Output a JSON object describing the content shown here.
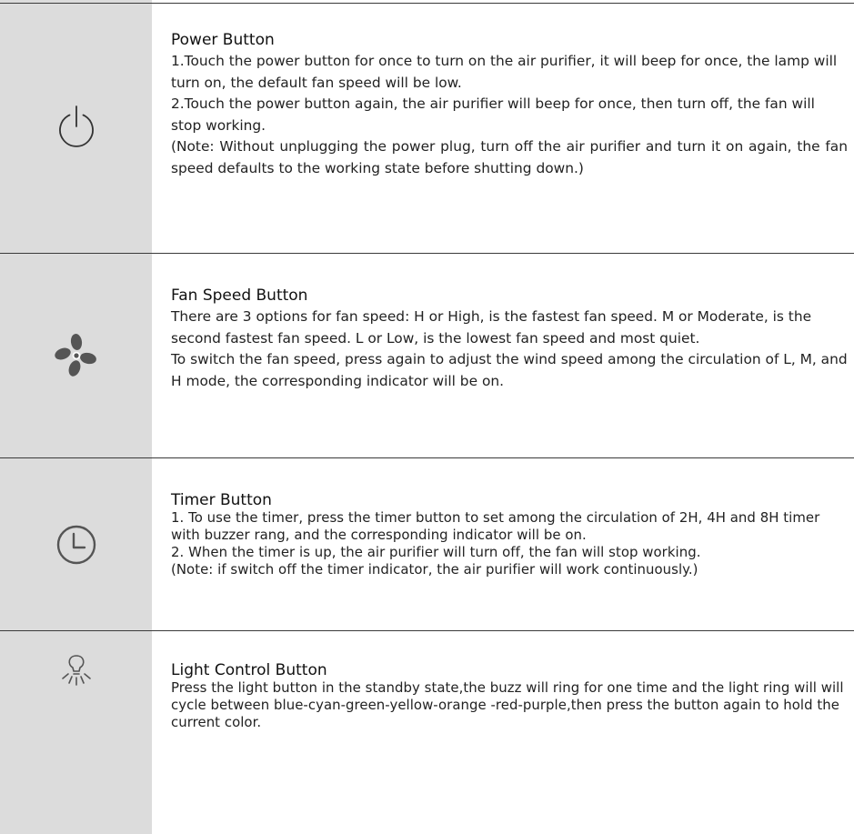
{
  "sections": [
    {
      "icon": "power-icon",
      "title": "Power Button",
      "paragraphs": [
        "1.Touch the power button for once to turn on the air purifier, it will beep for once, the lamp will turn on, the default fan speed will be low.",
        "2.Touch the power button again, the air purifier will beep for once, then turn off, the fan will stop working.",
        "(Note: Without unplugging the power plug, turn off the air purifier and turn it on again, the fan speed defaults to the working state before shutting down.)"
      ]
    },
    {
      "icon": "fan-icon",
      "title": "Fan Speed Button",
      "paragraphs": [
        "There are 3 options for fan speed: H or High, is the fastest fan speed. M or Moderate, is the second fastest fan speed. L or Low, is the lowest fan speed and most quiet.",
        "To switch the fan speed, press again to adjust the wind speed among the circulation of L, M, and H mode, the corresponding indicator will be on."
      ]
    },
    {
      "icon": "clock-icon",
      "title": "Timer Button",
      "paragraphs": [
        "1. To use the timer, press the timer button to set among the circulation of 2H, 4H and 8H timer with buzzer rang, and the corresponding indicator will be on.",
        "2. When the timer is up, the air purifier will turn off, the fan will stop working.",
        "(Note: if switch off the timer indicator, the air purifier will work continuously.)"
      ]
    },
    {
      "icon": "light-bulb-icon",
      "title": "Light Control Button",
      "paragraphs": [
        "Press the light button in the standby state,the buzz will ring for one time and the light ring will will cycle between blue-cyan-green-yellow-orange -red-purple,then press the button again to hold the current color."
      ]
    }
  ]
}
